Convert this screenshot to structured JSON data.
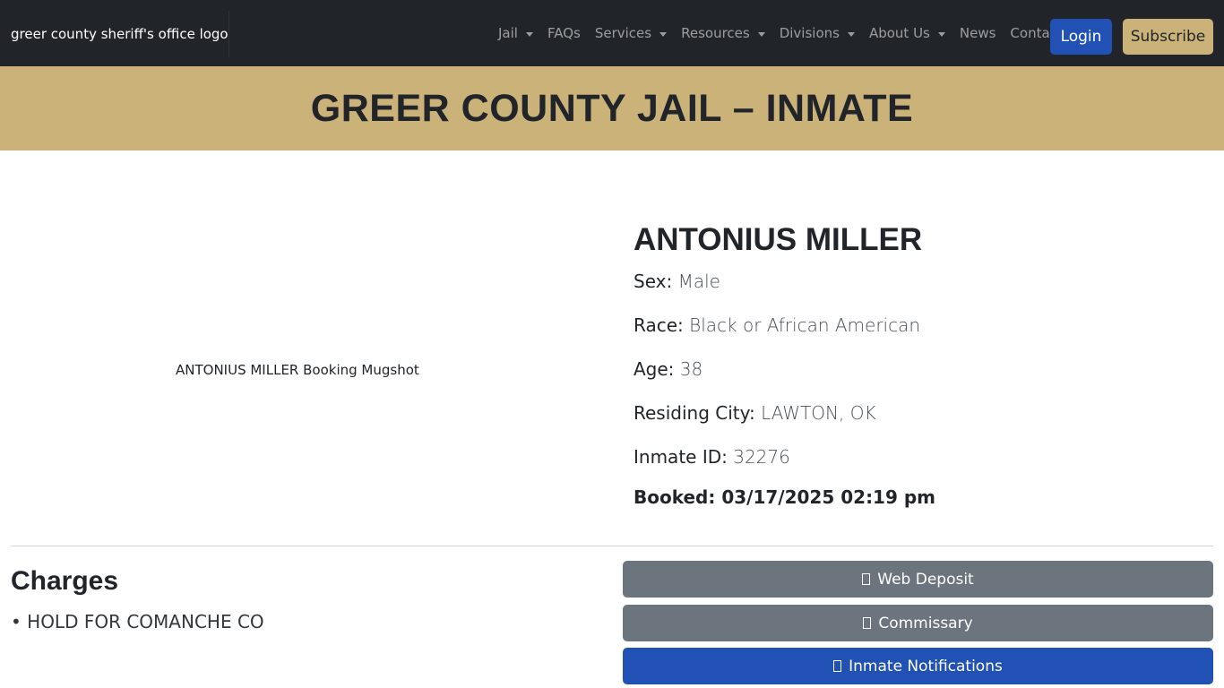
{
  "header": {
    "logo_alt": "greer county sheriff's office logo",
    "nav": [
      {
        "label": "Jail",
        "dropdown": true
      },
      {
        "label": "FAQs",
        "dropdown": false
      },
      {
        "label": "Services",
        "dropdown": true
      },
      {
        "label": "Resources",
        "dropdown": true
      },
      {
        "label": "Divisions",
        "dropdown": true
      },
      {
        "label": "About Us",
        "dropdown": true
      },
      {
        "label": "News",
        "dropdown": false
      },
      {
        "label": "Contact",
        "dropdown": false
      }
    ],
    "login_label": "Login",
    "subscribe_label": "Subscribe"
  },
  "banner": {
    "title": "GREER COUNTY JAIL – INMATE"
  },
  "inmate": {
    "mugshot_alt": "ANTONIUS MILLER Booking Mugshot",
    "name": "ANTONIUS MILLER",
    "sex_label": "Sex:",
    "sex": "Male",
    "race_label": "Race:",
    "race": "Black or African American",
    "age_label": "Age:",
    "age": "38",
    "city_label": "Residing City:",
    "city": "LAWTON, OK",
    "id_label": "Inmate ID:",
    "id": "32276",
    "booked": "Booked: 03/17/2025 02:19 pm"
  },
  "charges": {
    "title": "Charges",
    "items": [
      "• HOLD FOR COMANCHE CO"
    ]
  },
  "actions": {
    "web_deposit": "Web Deposit",
    "commissary": "Commissary",
    "notifications": "Inmate Notifications"
  },
  "colors": {
    "navbar_bg": "#212529",
    "gold": "#cbb279",
    "primary_blue": "#2251b6",
    "secondary_grey": "#6c757d"
  }
}
